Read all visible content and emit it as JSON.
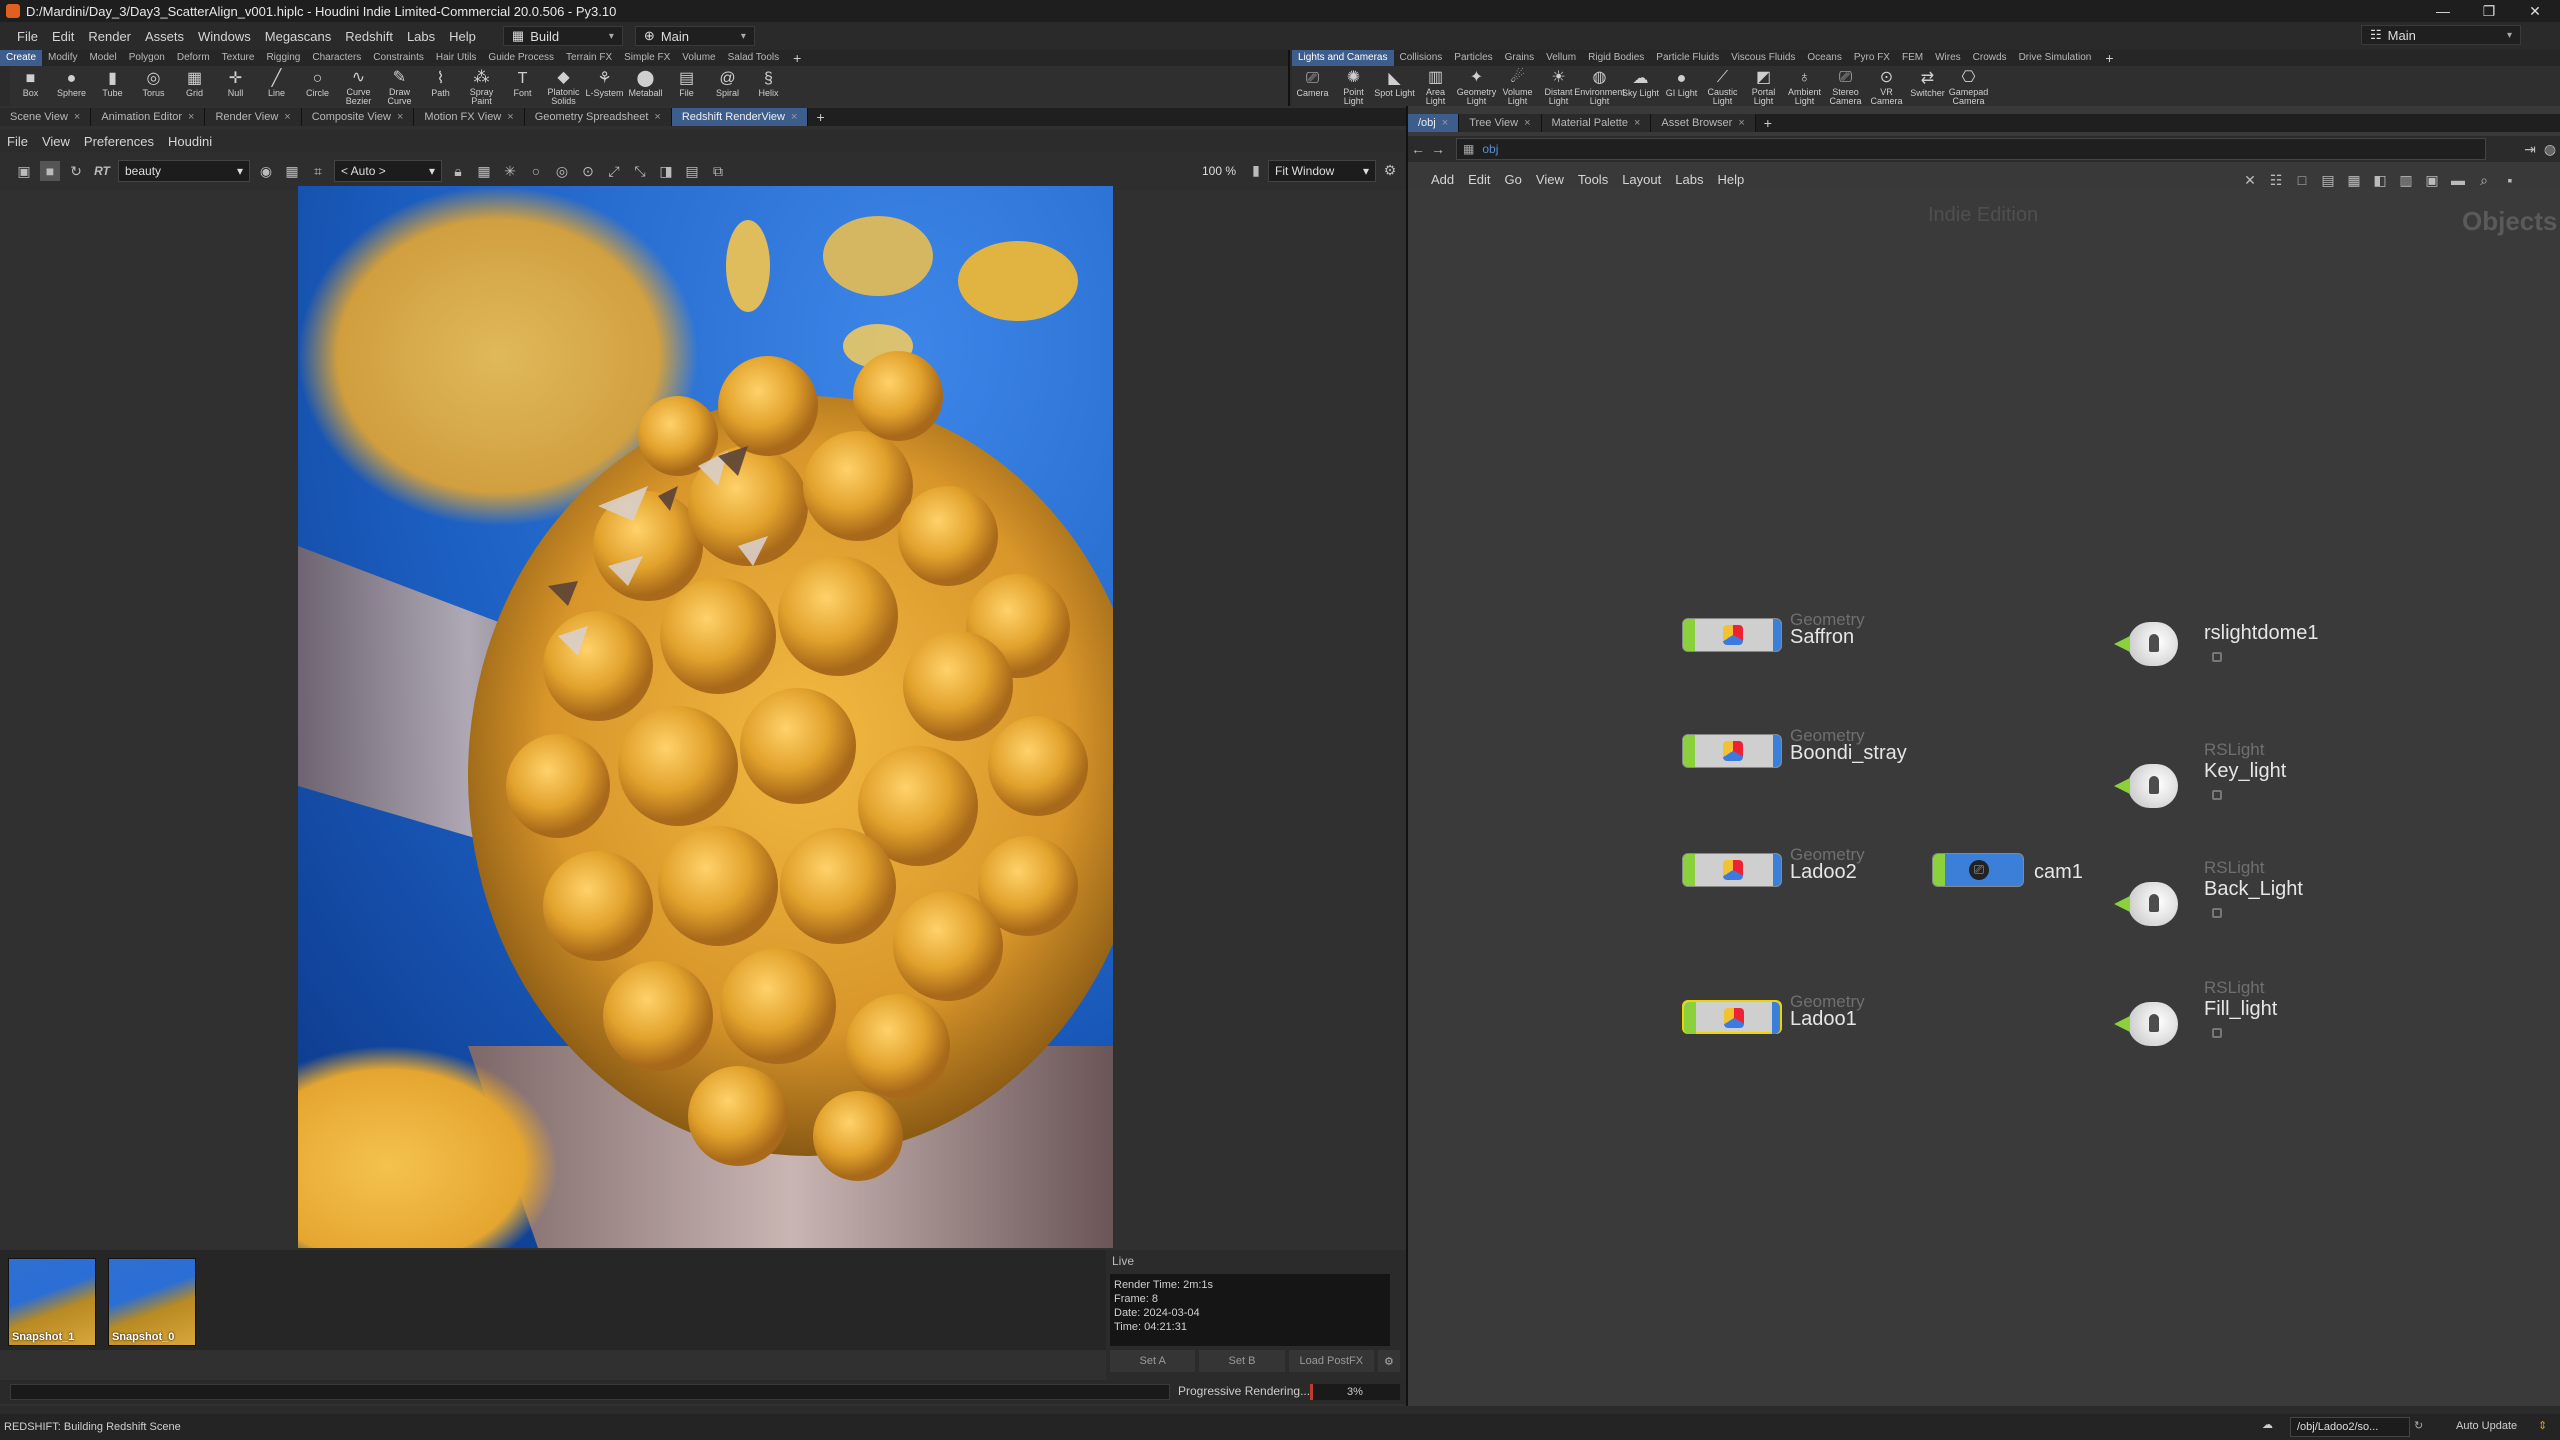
{
  "window": {
    "title": "D:/Mardini/Day_3/Day3_ScatterAlign_v001.hiplc - Houdini Indie Limited-Commercial 20.0.506 - Py3.10"
  },
  "menubar": {
    "items": [
      "File",
      "Edit",
      "Render",
      "Assets",
      "Windows",
      "Megascans",
      "Redshift",
      "Labs",
      "Help"
    ],
    "desktop_dd": "Build",
    "main_dd": "Main",
    "right_main": "Main"
  },
  "shelf_left": {
    "tabs": [
      "Create",
      "Modify",
      "Model",
      "Polygon",
      "Deform",
      "Texture",
      "Rigging",
      "Characters",
      "Constraints",
      "Hair Utils",
      "Guide Process",
      "Terrain FX",
      "Simple FX",
      "Volume",
      "Salad Tools"
    ],
    "tools": [
      {
        "label": "Box",
        "icon": "box-icon",
        "glyph": "■"
      },
      {
        "label": "Sphere",
        "icon": "sphere-icon",
        "glyph": "●"
      },
      {
        "label": "Tube",
        "icon": "tube-icon",
        "glyph": "▮"
      },
      {
        "label": "Torus",
        "icon": "torus-icon",
        "glyph": "◎"
      },
      {
        "label": "Grid",
        "icon": "grid-icon",
        "glyph": "▦"
      },
      {
        "label": "Null",
        "icon": "null-icon",
        "glyph": "✛"
      },
      {
        "label": "Line",
        "icon": "line-icon",
        "glyph": "╱"
      },
      {
        "label": "Circle",
        "icon": "circle-icon",
        "glyph": "○"
      },
      {
        "label": "Curve Bezier",
        "icon": "curve-bezier-icon",
        "glyph": "∿"
      },
      {
        "label": "Draw Curve",
        "icon": "draw-curve-icon",
        "glyph": "✎"
      },
      {
        "label": "Path",
        "icon": "path-icon",
        "glyph": "⌇"
      },
      {
        "label": "Spray Paint",
        "icon": "spray-paint-icon",
        "glyph": "⁂"
      },
      {
        "label": "Font",
        "icon": "font-icon",
        "glyph": "T"
      },
      {
        "label": "Platonic Solids",
        "icon": "platonic-icon",
        "glyph": "◆"
      },
      {
        "label": "L-System",
        "icon": "lsystem-icon",
        "glyph": "⚘"
      },
      {
        "label": "Metaball",
        "icon": "metaball-icon",
        "glyph": "⬤"
      },
      {
        "label": "File",
        "icon": "file-icon",
        "glyph": "▤"
      },
      {
        "label": "Spiral",
        "icon": "spiral-icon",
        "glyph": "@"
      },
      {
        "label": "Helix",
        "icon": "helix-icon",
        "glyph": "§"
      }
    ]
  },
  "shelf_right": {
    "tabs": [
      "Lights and Cameras",
      "Collisions",
      "Particles",
      "Grains",
      "Vellum",
      "Rigid Bodies",
      "Particle Fluids",
      "Viscous Fluids",
      "Oceans",
      "Pyro FX",
      "FEM",
      "Wires",
      "Crowds",
      "Drive Simulation"
    ],
    "tools": [
      {
        "label": "Camera",
        "icon": "camera-icon",
        "glyph": "⎚"
      },
      {
        "label": "Point Light",
        "icon": "point-light-icon",
        "glyph": "✺"
      },
      {
        "label": "Spot Light",
        "icon": "spot-light-icon",
        "glyph": "◣"
      },
      {
        "label": "Area Light",
        "icon": "area-light-icon",
        "glyph": "▥"
      },
      {
        "label": "Geometry Light",
        "icon": "geometry-light-icon",
        "glyph": "✦"
      },
      {
        "label": "Volume Light",
        "icon": "volume-light-icon",
        "glyph": "☄"
      },
      {
        "label": "Distant Light",
        "icon": "distant-light-icon",
        "glyph": "☀"
      },
      {
        "label": "Environment Light",
        "icon": "environment-light-icon",
        "glyph": "◍"
      },
      {
        "label": "Sky Light",
        "icon": "sky-light-icon",
        "glyph": "☁"
      },
      {
        "label": "GI Light",
        "icon": "gi-light-icon",
        "glyph": "●"
      },
      {
        "label": "Caustic Light",
        "icon": "caustic-light-icon",
        "glyph": "⟋"
      },
      {
        "label": "Portal Light",
        "icon": "portal-light-icon",
        "glyph": "◩"
      },
      {
        "label": "Ambient Light",
        "icon": "ambient-light-icon",
        "glyph": "♁"
      },
      {
        "label": "Stereo Camera",
        "icon": "stereo-camera-icon",
        "glyph": "⎚"
      },
      {
        "label": "VR Camera",
        "icon": "vr-camera-icon",
        "glyph": "⊙"
      },
      {
        "label": "Switcher",
        "icon": "switcher-icon",
        "glyph": "⇄"
      },
      {
        "label": "Gamepad Camera",
        "icon": "gamepad-camera-icon",
        "glyph": "⎔"
      }
    ]
  },
  "left_tabs": [
    "Scene View",
    "Animation Editor",
    "Render View",
    "Composite View",
    "Motion FX View",
    "Geometry Spreadsheet",
    "Redshift RenderView"
  ],
  "right_tabs": [
    "/obj",
    "Tree View",
    "Material Palette",
    "Asset Browser"
  ],
  "renderview": {
    "menu": [
      "File",
      "View",
      "Preferences",
      "Houdini"
    ],
    "aov": "beauty",
    "camera": "< Auto >",
    "zoom": "100 %",
    "fit": "Fit Window",
    "snapshots": [
      "Snapshot_1",
      "Snapshot_0"
    ],
    "live_title": "Live",
    "info": [
      "Render Time: 2m:1s",
      "Frame: 8",
      "Date: 2024-03-04",
      "Time: 04:21:31"
    ],
    "set_buttons": [
      "Set A",
      "Set B",
      "Load PostFX"
    ],
    "progress_label": "Progressive Rendering...",
    "progress_pct": "3%",
    "progress_value": 0.03
  },
  "network": {
    "path": "obj",
    "menu": [
      "Add",
      "Edit",
      "Go",
      "View",
      "Tools",
      "Layout",
      "Labs",
      "Help"
    ],
    "edition": "Indie Edition",
    "context": "Objects",
    "geo_nodes": [
      {
        "type": "Geometry",
        "name": "Saffron"
      },
      {
        "type": "Geometry",
        "name": "Boondi_stray"
      },
      {
        "type": "Geometry",
        "name": "Ladoo2"
      },
      {
        "type": "Geometry",
        "name": "Ladoo1"
      }
    ],
    "camera_node": {
      "name": "cam1"
    },
    "light_nodes": [
      {
        "type": "",
        "name": "rslightdome1"
      },
      {
        "type": "RSLight",
        "name": "Key_light"
      },
      {
        "type": "RSLight",
        "name": "Back_Light"
      },
      {
        "type": "RSLight",
        "name": "Fill_light"
      }
    ]
  },
  "status": {
    "left": "REDSHIFT: Building Redshift Scene",
    "path": "/obj/Ladoo2/so...",
    "update": "Auto Update"
  },
  "colors": {
    "accent": "#3d5d8c",
    "geo_green": "#8bd13b",
    "node_blue": "#3c7fd9",
    "render_sky": "#1c63c6",
    "ladoo": "#e0a62b"
  }
}
